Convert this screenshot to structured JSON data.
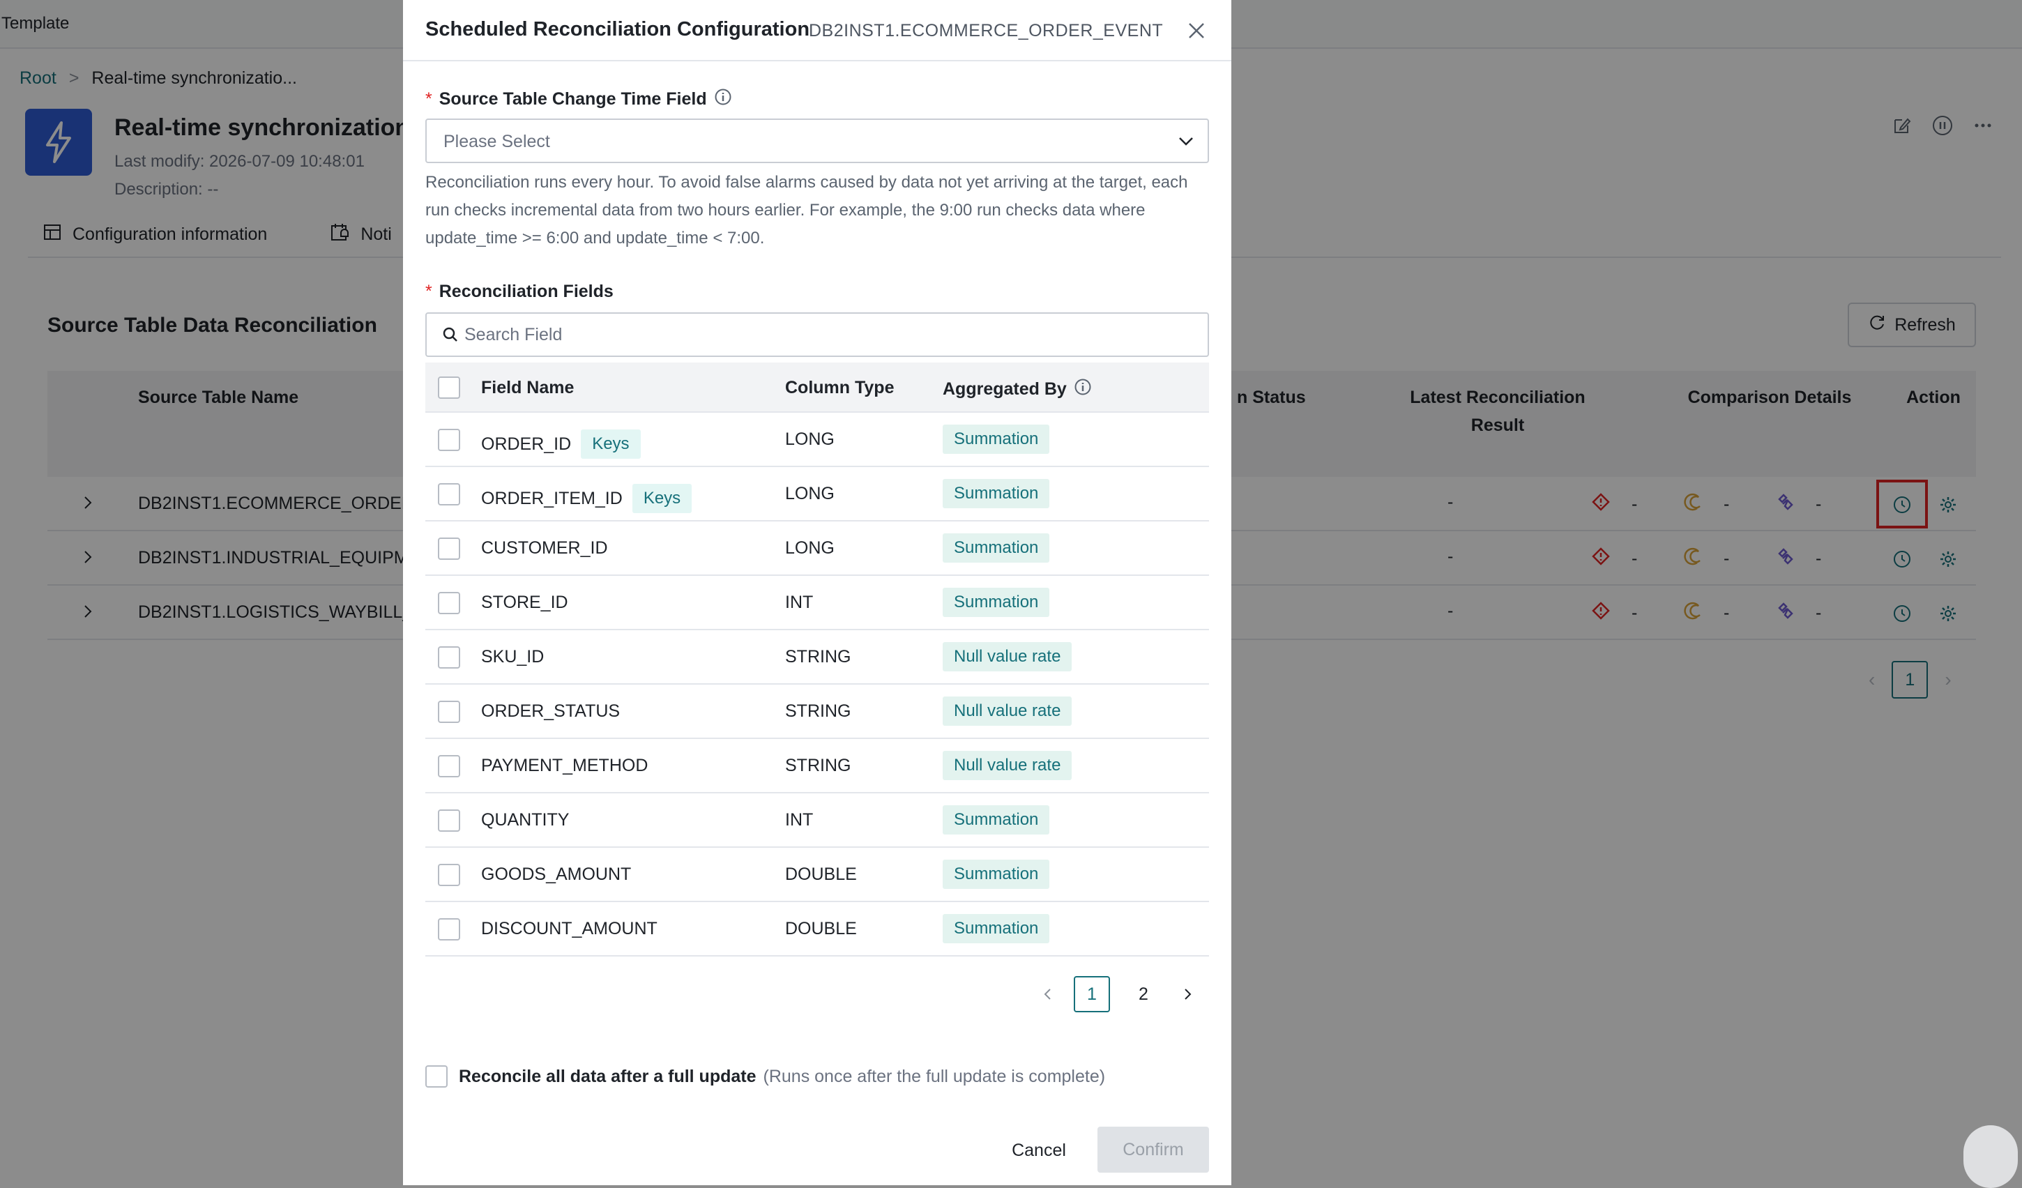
{
  "app": {
    "title": "Template"
  },
  "breadcrumb": {
    "root": "Root",
    "separator": ">",
    "current": "Real-time synchronizatio..."
  },
  "task": {
    "title": "Real-time synchronization c",
    "last_modify": "Last modify:  2026-07-09 10:48:01",
    "description": "Description:  --"
  },
  "page_tabs": [
    {
      "label": "Configuration information",
      "icon": "table-icon"
    },
    {
      "label": "Noti",
      "icon": "calendar-bell-icon"
    }
  ],
  "section": {
    "title": "Source Table Data Reconciliation",
    "refresh_label": "Refresh"
  },
  "table": {
    "headers": {
      "source_table_name": "Source Table Name",
      "status": "n Status",
      "latest_result_1": "Latest Reconciliation",
      "latest_result_2": "Result",
      "comparison_details": "Comparison Details",
      "action": "Action"
    },
    "rows": [
      {
        "name": "DB2INST1.ECOMMERCE_ORDER_",
        "result": "-",
        "diff": "-",
        "pending": "-",
        "relink": "-"
      },
      {
        "name": "DB2INST1.INDUSTRIAL_EQUIPME",
        "result": "-",
        "diff": "-",
        "pending": "-",
        "relink": "-"
      },
      {
        "name": "DB2INST1.LOGISTICS_WAYBILL_T",
        "result": "-",
        "diff": "-",
        "pending": "-",
        "relink": "-"
      }
    ],
    "pagination": {
      "current": "1"
    }
  },
  "modal": {
    "title": "Scheduled Reconciliation Configuration",
    "subtitle": "DB2INST1.ECOMMERCE_ORDER_EVENT",
    "time_field": {
      "required_mark": "*",
      "label": "Source Table Change Time Field",
      "placeholder": "Please Select",
      "help": "Reconciliation runs every hour. To avoid false alarms caused by data not yet arriving at the target, each run checks incremental data from two hours earlier. For example, the 9:00 run checks data where update_time >= 6:00 and update_time < 7:00."
    },
    "fields": {
      "required_mark": "*",
      "label": "Reconciliation Fields",
      "search_placeholder": "Search Field",
      "headers": {
        "name": "Field Name",
        "type": "Column Type",
        "agg": "Aggregated By"
      },
      "rows": [
        {
          "name": "ORDER_ID",
          "tag": "Keys",
          "type": "LONG",
          "agg": "Summation"
        },
        {
          "name": "ORDER_ITEM_ID",
          "tag": "Keys",
          "type": "LONG",
          "agg": "Summation"
        },
        {
          "name": "CUSTOMER_ID",
          "tag": "",
          "type": "LONG",
          "agg": "Summation"
        },
        {
          "name": "STORE_ID",
          "tag": "",
          "type": "INT",
          "agg": "Summation"
        },
        {
          "name": "SKU_ID",
          "tag": "",
          "type": "STRING",
          "agg": "Null value rate"
        },
        {
          "name": "ORDER_STATUS",
          "tag": "",
          "type": "STRING",
          "agg": "Null value rate"
        },
        {
          "name": "PAYMENT_METHOD",
          "tag": "",
          "type": "STRING",
          "agg": "Null value rate"
        },
        {
          "name": "QUANTITY",
          "tag": "",
          "type": "INT",
          "agg": "Summation"
        },
        {
          "name": "GOODS_AMOUNT",
          "tag": "",
          "type": "DOUBLE",
          "agg": "Summation"
        },
        {
          "name": "DISCOUNT_AMOUNT",
          "tag": "",
          "type": "DOUBLE",
          "agg": "Summation"
        }
      ],
      "pagination": {
        "pages": [
          "1",
          "2"
        ],
        "current": "1"
      }
    },
    "full_update": {
      "label": "Reconcile all data after a full update",
      "note": "(Runs once after the full update is complete)"
    },
    "cancel_label": "Cancel",
    "confirm_label": "Confirm"
  },
  "colors": {
    "accent": "#16707a",
    "brand_icon": "#2f5bd3",
    "danger": "#e02424",
    "warning": "#d9a23a",
    "link_purple": "#6d5bd0"
  }
}
